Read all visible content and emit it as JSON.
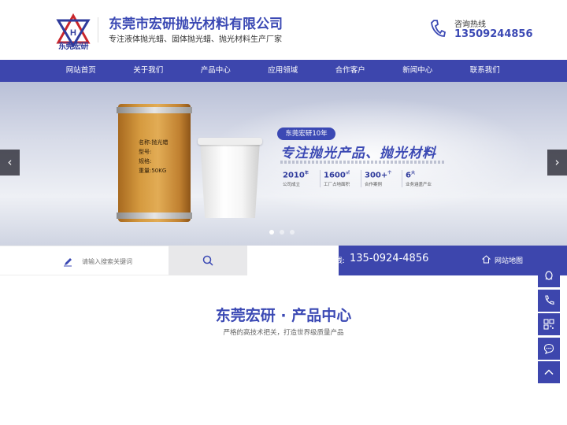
{
  "header": {
    "logo_text": "东莞宏研",
    "company_name": "东莞市宏研抛光材料有限公司",
    "slogan": "专注液体抛光蜡、固体抛光蜡、抛光材料生产厂家",
    "hotline_label": "咨询热线",
    "hotline_number": "13509244856"
  },
  "nav": {
    "items": [
      {
        "label": "网站首页"
      },
      {
        "label": "关于我们"
      },
      {
        "label": "产品中心"
      },
      {
        "label": "应用领域"
      },
      {
        "label": "合作客户"
      },
      {
        "label": "新闻中心"
      },
      {
        "label": "联系我们"
      }
    ]
  },
  "banner": {
    "barrel_labels": [
      "名称:抛光蜡",
      "型号:",
      "规格:",
      "重量:50KG"
    ],
    "tag": "东莞宏研10年",
    "headline": "专注抛光产品、抛光材料",
    "stats": [
      {
        "value": "2010",
        "sup": "年",
        "label": "公司成立"
      },
      {
        "value": "1600",
        "sup": "㎡",
        "label": "工厂占地面积"
      },
      {
        "value": "300+",
        "sup": "个",
        "label": "合作案例"
      },
      {
        "value": "6",
        "sup": "大",
        "label": "业务涵盖产业"
      }
    ],
    "prev_arrow": "‹",
    "next_arrow": "›",
    "slide_count": 3,
    "active_slide": 1
  },
  "searchbar": {
    "placeholder": "请输入搜索关键词",
    "hotline_label": "线:",
    "hotline_number": "135-0924-4856",
    "sitemap_label": "网站地图"
  },
  "section": {
    "title": "东莞宏研 · 产品中心",
    "subtitle": "严格的高技术把关，打造世界级质量产品"
  },
  "sidebar": {
    "buttons": [
      "qq-icon",
      "phone-icon",
      "qrcode-icon",
      "chat-icon",
      "back-to-top-icon"
    ]
  },
  "colors": {
    "brand_blue": "#3d46ad",
    "title_blue": "#3b49b4"
  }
}
